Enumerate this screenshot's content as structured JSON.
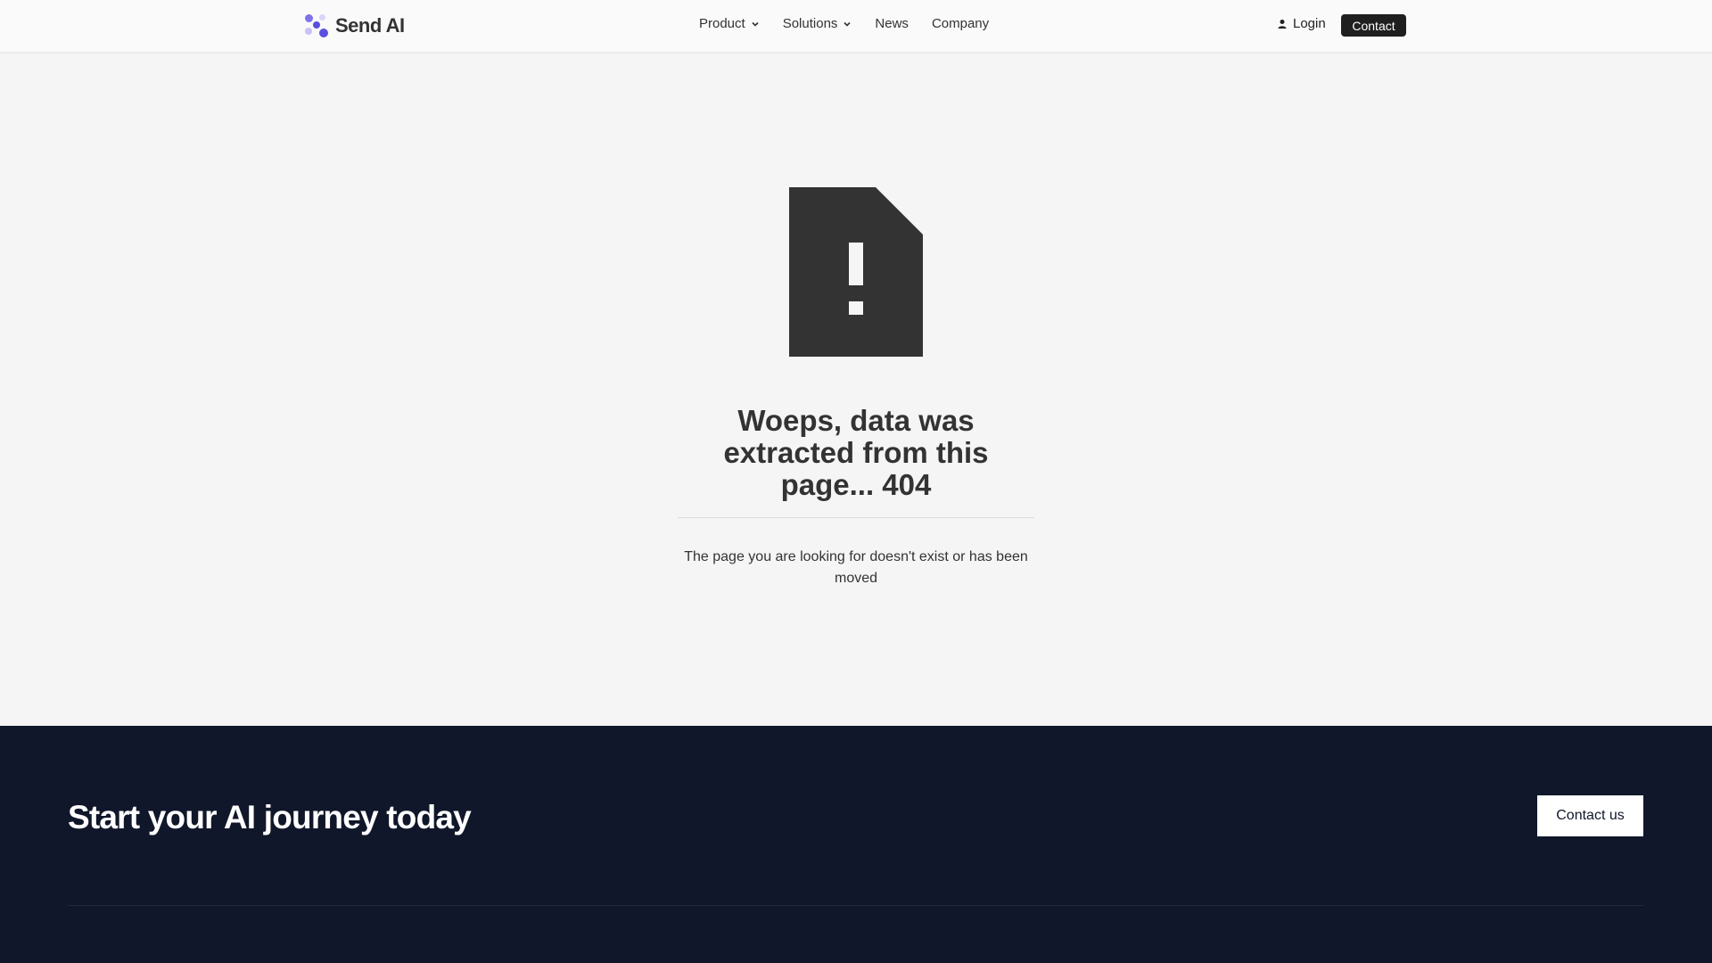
{
  "brand": {
    "name": "Send AI",
    "logo_colors": [
      "#5b4fe0",
      "#9a8ff0",
      "#c8c1f7"
    ]
  },
  "nav": {
    "items": [
      {
        "label": "Product",
        "has_dropdown": true
      },
      {
        "label": "Solutions",
        "has_dropdown": true
      },
      {
        "label": "News",
        "has_dropdown": false
      },
      {
        "label": "Company",
        "has_dropdown": false
      }
    ],
    "login_label": "Login",
    "contact_label": "Contact"
  },
  "error": {
    "icon": "document-alert-icon",
    "title": "Woeps, data was extracted from this page... 404",
    "message": "The page you are looking for doesn't exist or has been moved"
  },
  "footer": {
    "cta_title": "Start your AI journey today",
    "cta_button": "Contact us",
    "background": "#10172a"
  }
}
